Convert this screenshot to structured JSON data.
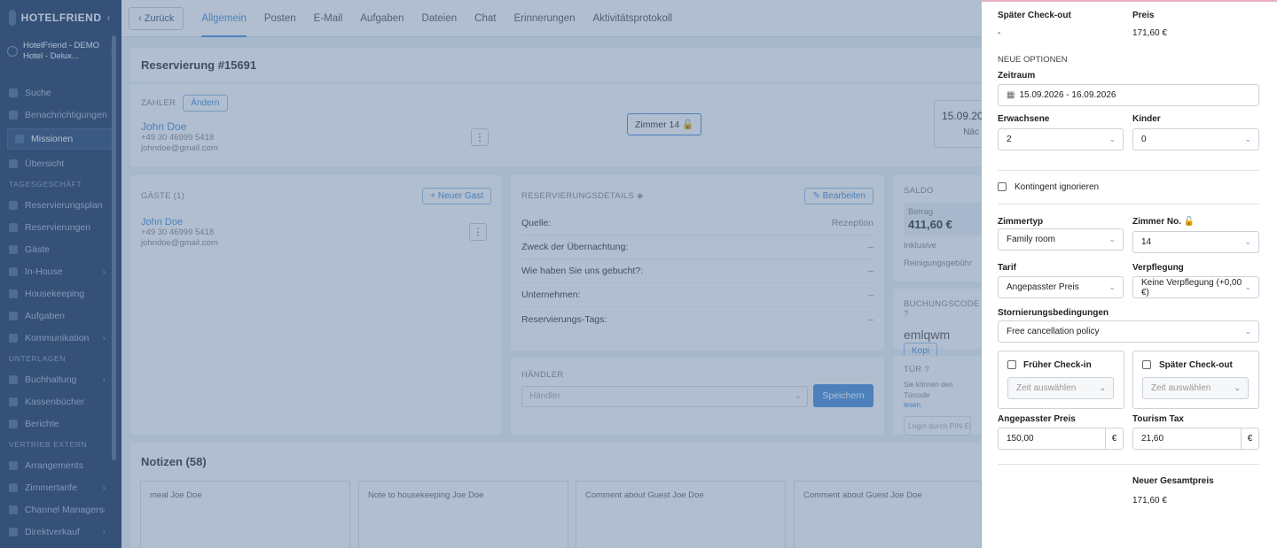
{
  "sidebar": {
    "brand": "HOTELFRIEND",
    "hotel": "HotelFriend - DEMO Hotel - Delux...",
    "items_top": [
      "Suche",
      "Benachrichtigungen"
    ],
    "active": "Missionen",
    "overview": "Übersicht",
    "sections": [
      {
        "title": "TAGESGESCHÄFT",
        "items": [
          "Reservierungsplan",
          "Reservierungen",
          "Gäste",
          "In-House",
          "Housekeeping",
          "Aufgaben",
          "Kommunikation"
        ]
      },
      {
        "title": "UNTERLAGEN",
        "items": [
          "Buchhaltung",
          "Kassenbücher",
          "Berichte"
        ]
      },
      {
        "title": "VERTRIEB EXTERN",
        "items": [
          "Arrangements",
          "Zimmertarife",
          "Channel Managers",
          "Direktverkauf"
        ]
      }
    ]
  },
  "tabs": {
    "back": "Zurück",
    "items": [
      "Allgemein",
      "Posten",
      "E-Mail",
      "Aufgaben",
      "Dateien",
      "Chat",
      "Erinnerungen",
      "Aktivitätsprotokoll"
    ]
  },
  "reservation": {
    "title": "Reservierung #15691",
    "payer_label": "ZAHLER",
    "change": "Ändern",
    "name": "John Doe",
    "phone": "+49 30 46999 5418",
    "email": "johndoe@gmail.com",
    "room": "Zimmer 14",
    "date": "15.09.20",
    "nights": "Näc"
  },
  "guests": {
    "title": "GÄSTE (1)",
    "new_guest": "+ Neuer Gast",
    "name": "John Doe",
    "phone": "+49 30 46999 5418",
    "email": "johndoe@gmail.com"
  },
  "details": {
    "title": "RESERVIERUNGSDETAILS",
    "edit": "Bearbeiten",
    "rows": [
      {
        "k": "Quelle:",
        "v": "Rezeption"
      },
      {
        "k": "Zweck der Übernachtung:",
        "v": "–"
      },
      {
        "k": "Wie haben Sie uns gebucht?:",
        "v": "–"
      },
      {
        "k": "Unternehmen:",
        "v": "–"
      },
      {
        "k": "Reservierungs-Tags:",
        "v": "–"
      }
    ],
    "dealer_label": "HÄNDLER",
    "dealer_placeholder": "Händler",
    "save": "Speichern"
  },
  "saldo": {
    "title": "SALDO",
    "betrag": "Betrag",
    "amount": "411,60 €",
    "inklusive": "Inklusive",
    "cleaning": "Reinigungsgebühr",
    "booking_code_label": "BUCHUNGSCODE",
    "booking_code": "emlqwm",
    "copy": "Kopi",
    "door_label": "TÜR",
    "door_text": "Sie können den Türcode",
    "door_link": "lesen",
    "door_placeholder": "Login durch PIN Eing"
  },
  "notes": {
    "title": "Notizen (58)",
    "items": [
      "meal Joe Doe",
      "Note to housekeeping Joe Doe",
      "Comment about Guest Joe Doe",
      "Comment about Guest Joe Doe"
    ]
  },
  "panel": {
    "late_checkout_label": "Später Check-out",
    "late_checkout_value": "-",
    "price_label": "Preis",
    "price_value": "171,60 €",
    "new_options": "NEUE OPTIONEN",
    "period_label": "Zeitraum",
    "period_value": "15.09.2026 - 16.09.2026",
    "adults_label": "Erwachsene",
    "adults_value": "2",
    "children_label": "Kinder",
    "children_value": "0",
    "ignore_quota": "Kontingent ignorieren",
    "room_type_label": "Zimmertyp",
    "room_type_value": "Family room",
    "room_no_label": "Zimmer No.",
    "room_no_value": "14",
    "tariff_label": "Tarif",
    "tariff_value": "Angepasster Preis",
    "board_label": "Verpflegung",
    "board_value": "Keine Verpflegung (+0,00 €)",
    "cancel_label": "Stornierungsbedingungen",
    "cancel_value": "Free cancellation policy",
    "early_checkin": "Früher Check-in",
    "late_checkout": "Später Check-out",
    "time_placeholder": "Zeit auswählen",
    "custom_price_label": "Angepasster Preis",
    "custom_price_value": "150,00",
    "tourism_tax_label": "Tourism Tax",
    "tourism_tax_value": "21,60",
    "currency": "€",
    "new_total_label": "Neuer Gesamtpreis",
    "new_total_value": "171,60 €"
  }
}
